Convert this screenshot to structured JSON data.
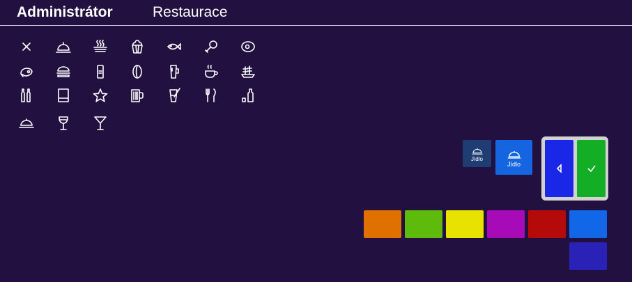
{
  "header": {
    "admin_title": "Administrátor",
    "restaurant_title": "Restaurace"
  },
  "icons": [
    "close-icon",
    "cloche-icon",
    "hot-dish-icon",
    "popcorn-icon",
    "fish-icon",
    "drumstick-icon",
    "egg-icon",
    "steak-icon",
    "burger-icon",
    "soda-can-icon",
    "coffee-bean-icon",
    "beer-glass-icon",
    "hot-cup-icon",
    "ship-icon",
    "bottles-icon",
    "tumbler-glass-icon",
    "star-icon",
    "beer-mug-icon",
    "cocktail-straw-icon",
    "cutlery-icon",
    "bottle-shot-icon",
    "serving-plate-icon",
    "wine-glass-icon",
    "martini-glass-icon"
  ],
  "preview": {
    "small_label": "Jídlo",
    "large_label": "Jídlo",
    "small_color": "#1f3d72",
    "large_color": "#1565e0"
  },
  "nav": {
    "back_color": "#1a27e6",
    "confirm_color": "#13ad26"
  },
  "colors": [
    "#e07000",
    "#5ebb0b",
    "#e8e200",
    "#a70bb8",
    "#b40a0a",
    "#1267e8",
    "#2a22b6"
  ]
}
